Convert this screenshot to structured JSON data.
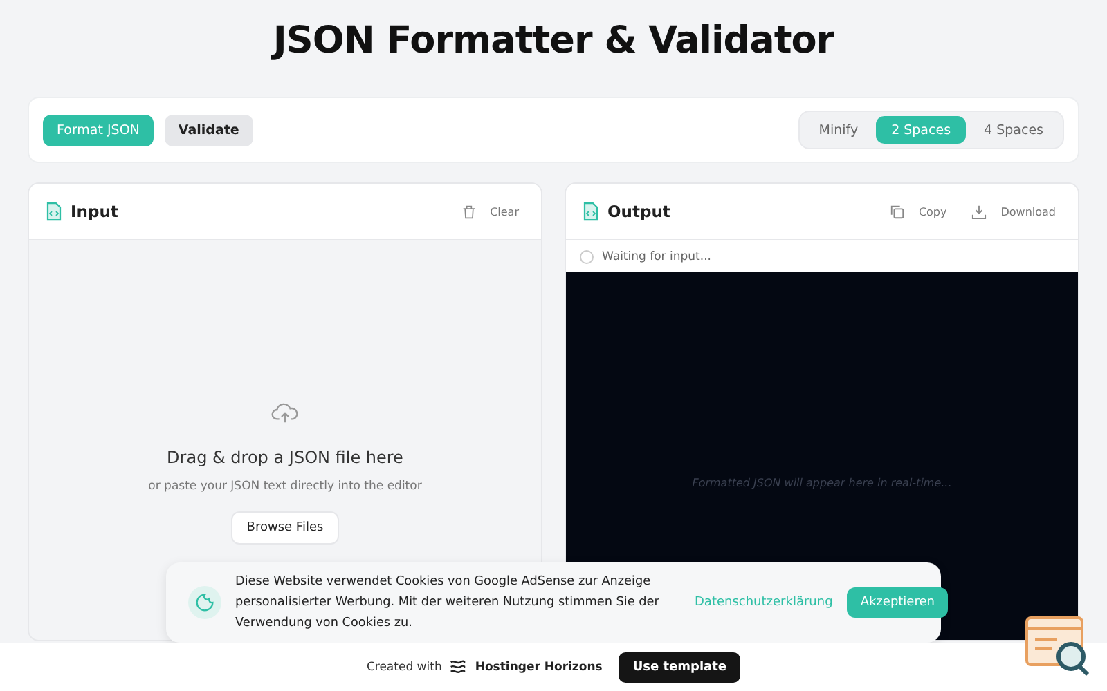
{
  "title": "JSON Formatter & Validator",
  "actions": [
    {
      "label": "Format JSON",
      "kind": "primary"
    },
    {
      "label": "Validate",
      "kind": "secondary"
    }
  ],
  "indent_options": [
    {
      "label": "Minify",
      "selected": false
    },
    {
      "label": "2 Spaces",
      "selected": true
    },
    {
      "label": "4 Spaces",
      "selected": false
    }
  ],
  "input_panel": {
    "title": "Input",
    "clear": "Clear",
    "drop_title": "Drag & drop a JSON file here",
    "drop_hint": "or paste your JSON text directly into the editor",
    "browse": "Browse Files"
  },
  "output_panel": {
    "title": "Output",
    "copy": "Copy",
    "download": "Download",
    "status": "Waiting for input...",
    "placeholder": "Formatted JSON will appear here in real-time..."
  },
  "cookie_banner": {
    "text": "Diese Website verwendet Cookies von Google AdSense zur Anzeige personalisierter Werbung. Mit der weiteren Nutzung stimmen Sie der Verwendung von Cookies zu.",
    "privacy_link": "Datenschutzerklärung",
    "accept": "Akzeptieren"
  },
  "footer": {
    "created_with": "Created with",
    "brand": "Hostinger Horizons",
    "use_template": "Use template"
  }
}
